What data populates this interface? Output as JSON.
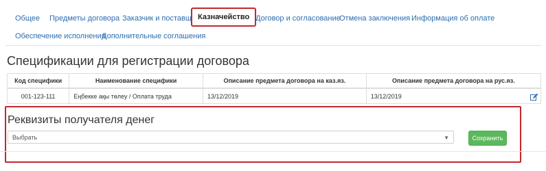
{
  "tabs": [
    {
      "label": "Общее"
    },
    {
      "label": "Предметы договора"
    },
    {
      "label": "Заказчик и поставщик"
    },
    {
      "label": "Казначейство"
    },
    {
      "label": "Договор и согласование"
    },
    {
      "label": "Отмена заключения"
    },
    {
      "label": "Информация об оплате"
    },
    {
      "label": "Обеспечение исполнения"
    },
    {
      "label": "Дополнительные соглашения"
    }
  ],
  "active_tab": "Казначейство",
  "specs": {
    "title": "Спецификации для регистрации договора",
    "columns": [
      "Код специфики",
      "Наименование специфики",
      "Описание предмета договора на каз.яз.",
      "Описание предмета договора на рус.яз."
    ],
    "rows": [
      {
        "code": "001-123-111",
        "name": "Еңбекке ақы төлеу / Оплата труда",
        "desc_kz": "13/12/2019",
        "desc_ru": "13/12/2019"
      }
    ]
  },
  "recipient": {
    "title": "Реквизиты получателя денег",
    "select_value": "Выбрать",
    "save_label": "Сохранить"
  },
  "colors": {
    "link": "#2a6db0",
    "highlight": "#c0272d",
    "save_button": "#5cb85c"
  }
}
